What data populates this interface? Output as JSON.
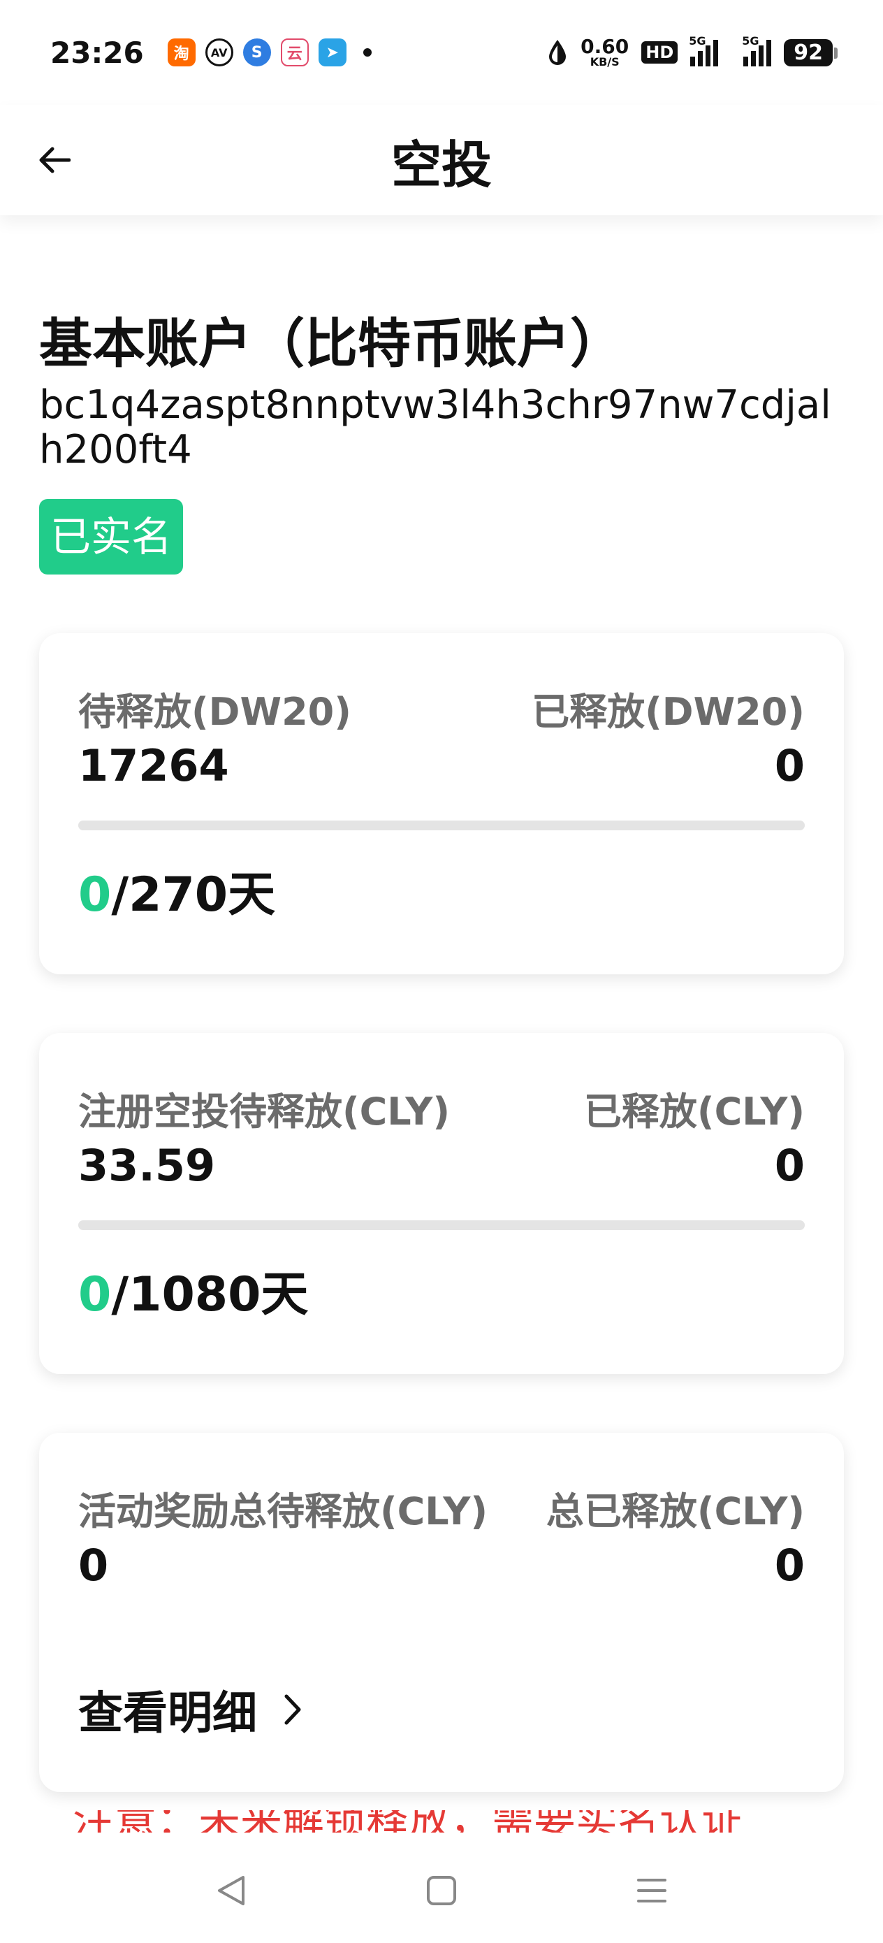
{
  "status_bar": {
    "time": "23:26",
    "app_icons": [
      {
        "name": "taobao-icon",
        "glyph": "淘",
        "color": "#ff6a00"
      },
      {
        "name": "av-icon",
        "glyph": "AV",
        "color": "#ffffff"
      },
      {
        "name": "swirl-app-icon",
        "glyph": "S",
        "color": "#2f7de1"
      },
      {
        "name": "ai-app-icon",
        "glyph": "云",
        "color": "#e24b6b"
      },
      {
        "name": "telegram-icon",
        "glyph": "➤",
        "color": "#2aa3e6"
      }
    ],
    "net_speed_value": "0.60",
    "net_speed_unit": "KB/S",
    "hd_label": "HD",
    "signal1_tag": "5G",
    "signal2_tag": "5G",
    "battery": "92"
  },
  "app_bar": {
    "title": "空投"
  },
  "account": {
    "title": "基本账户（比特币账户）",
    "address": "bc1q4zaspt8nnptvw3l4h3chr97nw7cdjalh200ft4",
    "verified_label": "已实名"
  },
  "cards": {
    "dw20": {
      "pending_label": "待释放(DW20)",
      "released_label": "已释放(DW20)",
      "pending_value": "17264",
      "released_value": "0",
      "progress_done": "0",
      "progress_total": "/270天",
      "progress_fraction": 0
    },
    "cly": {
      "pending_label": "注册空投待释放(CLY)",
      "released_label": "已释放(CLY)",
      "pending_value": "33.59",
      "released_value": "0",
      "progress_done": "0",
      "progress_total": "/1080天",
      "progress_fraction": 0
    },
    "activity": {
      "pending_label": "活动奖励总待释放(CLY)",
      "released_label": "总已释放(CLY)",
      "pending_value": "0",
      "released_value": "0",
      "detail_label": "查看明细"
    }
  },
  "notice": "注意：未来解锁释放，需要实名认证",
  "colors": {
    "accent": "#21cc8a",
    "notice": "#e53935"
  }
}
